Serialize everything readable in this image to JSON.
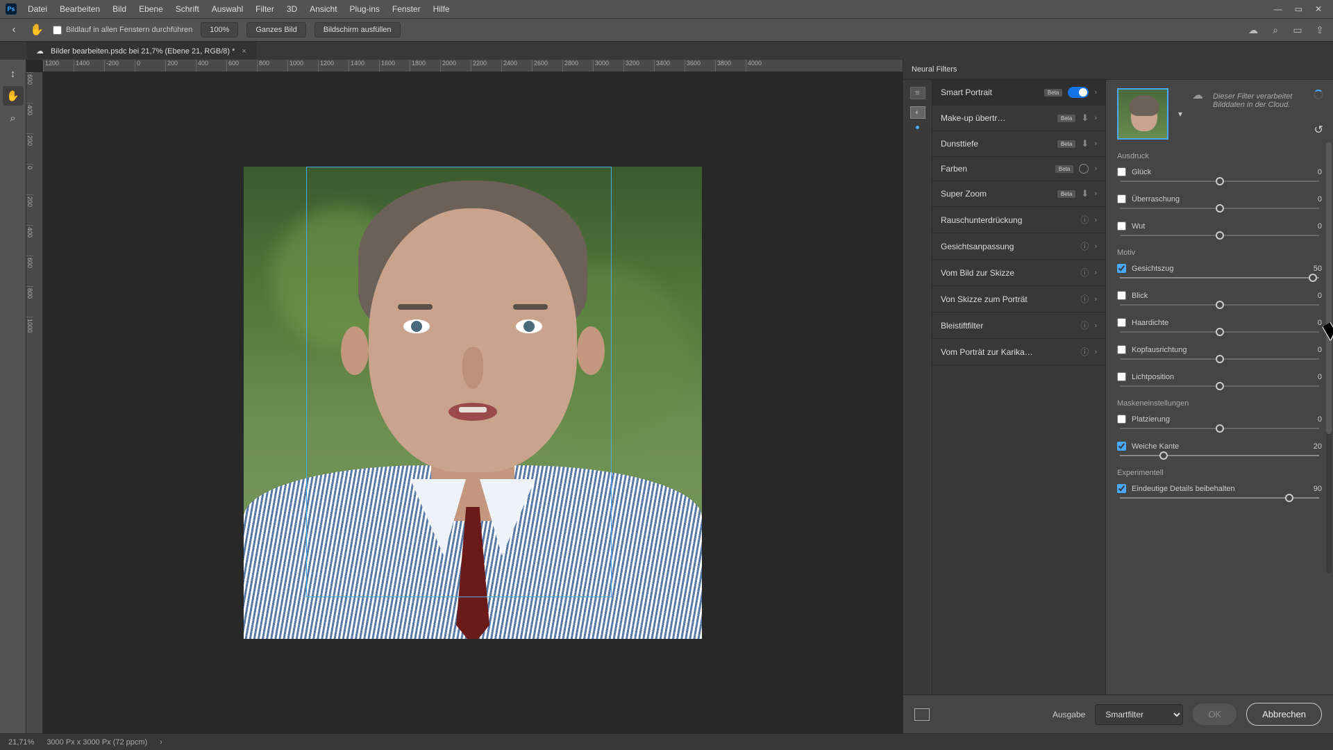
{
  "menu": [
    "Datei",
    "Bearbeiten",
    "Bild",
    "Ebene",
    "Schrift",
    "Auswahl",
    "Filter",
    "3D",
    "Ansicht",
    "Plug-ins",
    "Fenster",
    "Hilfe"
  ],
  "optbar": {
    "scroll_check": "Bildlauf in allen Fenstern durchführen",
    "zoom": "100%",
    "btn1": "Ganzes Bild",
    "btn2": "Bildschirm ausfüllen"
  },
  "doctab": {
    "title": "Bilder bearbeiten.psdc bei 21,7% (Ebene 21, RGB/8) *"
  },
  "ruler_h": [
    "1200",
    "1400",
    "-200",
    "0",
    "200",
    "400",
    "600",
    "800",
    "1000",
    "1200",
    "1400",
    "1600",
    "1800",
    "2000",
    "2200",
    "2400",
    "2600",
    "2800",
    "3000",
    "3200",
    "3400",
    "3600",
    "3800",
    "4000"
  ],
  "ruler_v": [
    "600",
    "400",
    "200",
    "0",
    "200",
    "400",
    "600",
    "800",
    "1000"
  ],
  "panel_title": "Neural Filters",
  "filters": [
    {
      "name": "Smart Portrait",
      "beta": true,
      "right": "toggle"
    },
    {
      "name": "Make-up übertr…",
      "beta": true,
      "right": "dl"
    },
    {
      "name": "Dunsttiefe",
      "beta": true,
      "right": "dl"
    },
    {
      "name": "Farben",
      "beta": true,
      "right": "ring"
    },
    {
      "name": "Super Zoom",
      "beta": true,
      "right": "dl"
    },
    {
      "name": "Rauschunterdrückung",
      "beta": false,
      "right": "info"
    },
    {
      "name": "Gesichtsanpassung",
      "beta": false,
      "right": "info"
    },
    {
      "name": "Vom Bild zur Skizze",
      "beta": false,
      "right": "info"
    },
    {
      "name": "Von Skizze zum Porträt",
      "beta": false,
      "right": "info"
    },
    {
      "name": "Bleistiftfilter",
      "beta": false,
      "right": "info"
    },
    {
      "name": "Vom Porträt zur Karika…",
      "beta": false,
      "right": "info"
    }
  ],
  "cloud_note": "Dieser Filter verarbeitet Bilddaten in der Cloud.",
  "sections": {
    "ausdruck": "Ausdruck",
    "motiv": "Motiv",
    "maske": "Maskeneinstellungen",
    "exp": "Experimentell"
  },
  "sliders": {
    "glueck": {
      "label": "Glück",
      "value": "0",
      "checked": false,
      "pos": 50
    },
    "ueberraschung": {
      "label": "Überraschung",
      "value": "0",
      "checked": false,
      "pos": 50
    },
    "wut": {
      "label": "Wut",
      "value": "0",
      "checked": false,
      "pos": 50
    },
    "gesichtszug": {
      "label": "Gesichtszug",
      "value": "50",
      "checked": true,
      "pos": 97
    },
    "blick": {
      "label": "Blick",
      "value": "0",
      "checked": false,
      "pos": 50
    },
    "haardichte": {
      "label": "Haardichte",
      "value": "0",
      "checked": false,
      "pos": 50
    },
    "kopfausrichtung": {
      "label": "Kopfausrichtung",
      "value": "0",
      "checked": false,
      "pos": 50
    },
    "lichtposition": {
      "label": "Lichtposition",
      "value": "0",
      "checked": false,
      "pos": 50
    },
    "platzierung": {
      "label": "Platzierung",
      "value": "0",
      "checked": false,
      "pos": 50
    },
    "weichekante": {
      "label": "Weiche Kante",
      "value": "20",
      "checked": true,
      "pos": 22
    },
    "details": {
      "label": "Eindeutige Details beibehalten",
      "value": "90",
      "checked": true,
      "pos": 85
    }
  },
  "footer": {
    "output_label": "Ausgabe",
    "output_value": "Smartfilter",
    "ok": "OK",
    "cancel": "Abbrechen"
  },
  "status": {
    "zoom": "21,71%",
    "dims": "3000 Px x 3000 Px (72 ppcm)"
  }
}
